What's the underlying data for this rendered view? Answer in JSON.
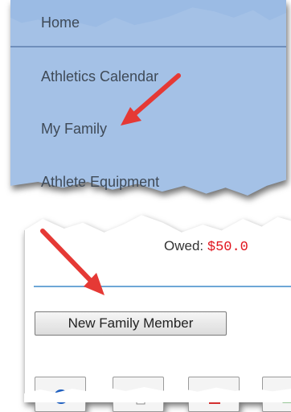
{
  "menu": {
    "items": [
      {
        "label": "Home"
      },
      {
        "label": "Athletics Calendar"
      },
      {
        "label": "My Family"
      },
      {
        "label": "Athlete Equipment"
      }
    ]
  },
  "account": {
    "owed_label": "Owed:",
    "owed_amount": "$50.0"
  },
  "actions": {
    "new_family_member_label": "New Family Member"
  },
  "toolbar": {
    "buttons": [
      {
        "icon": "help-icon"
      },
      {
        "icon": "copy-icon"
      },
      {
        "icon": "pdf-icon"
      },
      {
        "icon": "export-icon"
      }
    ]
  },
  "colors": {
    "menu_background": "#a4c1e6",
    "owed_amount": "#e0141e",
    "arrow": "#e53935",
    "divider": "#6ea7d6"
  }
}
